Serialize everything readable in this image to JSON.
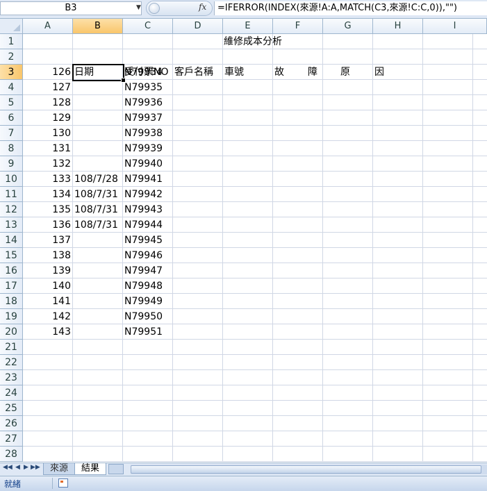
{
  "formula_bar": {
    "name_box": "B3",
    "fx_label": "fx",
    "formula": "=IFERROR(INDEX(來源!A:A,MATCH(C3,來源!C:C,0)),\"\")"
  },
  "columns": [
    "A",
    "B",
    "C",
    "D",
    "E",
    "F",
    "G",
    "H",
    "I"
  ],
  "rows": [
    "1",
    "2",
    "3",
    "4",
    "5",
    "6",
    "7",
    "8",
    "9",
    "10",
    "11",
    "12",
    "13",
    "14",
    "15",
    "16",
    "17",
    "18",
    "19",
    "20",
    "21",
    "22",
    "23",
    "24",
    "25",
    "26",
    "27",
    "28"
  ],
  "sheet": {
    "title": "維修成本分析",
    "headers": {
      "B": "日期",
      "C": "受付票NO",
      "D": "客戶名稱",
      "E": "車號",
      "F1": "故",
      "F2": "障",
      "G": "原",
      "H": "因"
    },
    "data_rows": [
      {
        "A": "126",
        "B": "",
        "C": "N79934"
      },
      {
        "A": "127",
        "B": "",
        "C": "N79935"
      },
      {
        "A": "128",
        "B": "",
        "C": "N79936"
      },
      {
        "A": "129",
        "B": "",
        "C": "N79937"
      },
      {
        "A": "130",
        "B": "",
        "C": "N79938"
      },
      {
        "A": "131",
        "B": "",
        "C": "N79939"
      },
      {
        "A": "132",
        "B": "",
        "C": "N79940"
      },
      {
        "A": "133",
        "B": "108/7/28",
        "C": "N79941"
      },
      {
        "A": "134",
        "B": "108/7/31",
        "C": "N79942"
      },
      {
        "A": "135",
        "B": "108/7/31",
        "C": "N79943"
      },
      {
        "A": "136",
        "B": "108/7/31",
        "C": "N79944"
      },
      {
        "A": "137",
        "B": "",
        "C": "N79945"
      },
      {
        "A": "138",
        "B": "",
        "C": "N79946"
      },
      {
        "A": "139",
        "B": "",
        "C": "N79947"
      },
      {
        "A": "140",
        "B": "",
        "C": "N79948"
      },
      {
        "A": "141",
        "B": "",
        "C": "N79949"
      },
      {
        "A": "142",
        "B": "",
        "C": "N79950"
      },
      {
        "A": "143",
        "B": "",
        "C": "N79951"
      }
    ]
  },
  "tabs": {
    "nav_first": "◀◀",
    "nav_prev": "◀",
    "nav_next": "▶",
    "nav_last": "▶▶",
    "items": [
      "來源",
      "結果"
    ],
    "active": "結果"
  },
  "status": {
    "text": "就緒"
  },
  "colors": {
    "selected_header": "#f9c66b",
    "grid_line": "#d0d7e5",
    "chrome": "#dfe8f5"
  }
}
